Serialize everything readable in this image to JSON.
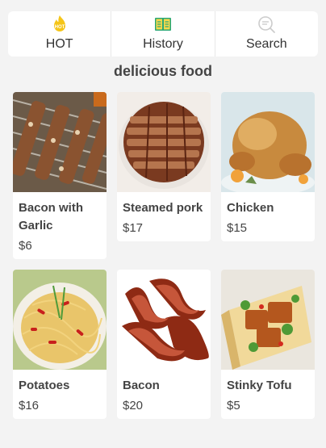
{
  "nav": {
    "items": [
      {
        "label": "HOT",
        "icon": "hot-flame-icon",
        "color": "#f5c518"
      },
      {
        "label": "History",
        "icon": "open-book-icon",
        "color": "#2aa876"
      },
      {
        "label": "Search",
        "icon": "search-icon",
        "color": "#cccccc"
      }
    ],
    "hot_badge": "HOT"
  },
  "section_title": "delicious food",
  "foods": [
    {
      "name": "Bacon with Garlic",
      "price": "$6"
    },
    {
      "name": "Steamed pork",
      "price": "$17"
    },
    {
      "name": "Chicken",
      "price": "$15"
    },
    {
      "name": "Potatoes",
      "price": "$16"
    },
    {
      "name": "Bacon",
      "price": "$20"
    },
    {
      "name": "Stinky Tofu",
      "price": "$5"
    }
  ]
}
